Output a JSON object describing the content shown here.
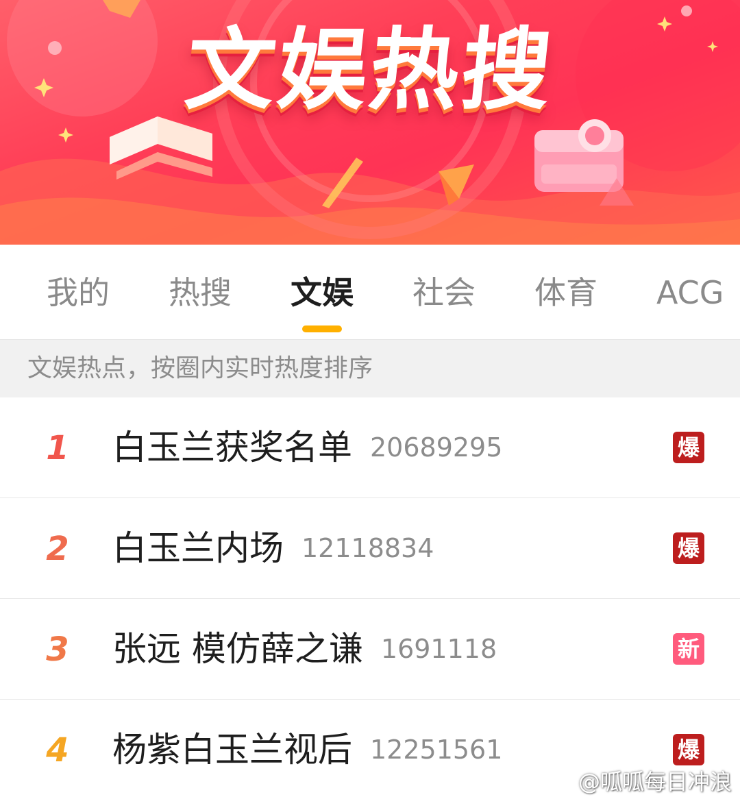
{
  "banner": {
    "title": "文娱热搜"
  },
  "tabs": [
    {
      "label": "我的",
      "active": false
    },
    {
      "label": "热搜",
      "active": false
    },
    {
      "label": "文娱",
      "active": true
    },
    {
      "label": "社会",
      "active": false
    },
    {
      "label": "体育",
      "active": false
    },
    {
      "label": "ACG",
      "active": false
    }
  ],
  "subheader": {
    "text": "文娱热点，按圈内实时热度排序"
  },
  "list": [
    {
      "rank": "1",
      "title": "白玉兰获奖名单",
      "count": "20689295",
      "badge": "爆",
      "badge_type": "hot"
    },
    {
      "rank": "2",
      "title": "白玉兰内场",
      "count": "12118834",
      "badge": "爆",
      "badge_type": "hot"
    },
    {
      "rank": "3",
      "title": "张远 模仿薛之谦",
      "count": "1691118",
      "badge": "新",
      "badge_type": "new"
    },
    {
      "rank": "4",
      "title": "杨紫白玉兰视后",
      "count": "12251561",
      "badge": "爆",
      "badge_type": "hot"
    }
  ],
  "watermark": {
    "text": "@呱呱每日冲浪",
    "icon": "weibo-logo"
  },
  "colors": {
    "banner_red": "#ff3f57",
    "tab_indicator": "#ffb000",
    "badge_hot": "#bd1e1e",
    "badge_new": "#ff5b7d",
    "rank_1": "#f1564d",
    "rank_4": "#f5a623"
  }
}
